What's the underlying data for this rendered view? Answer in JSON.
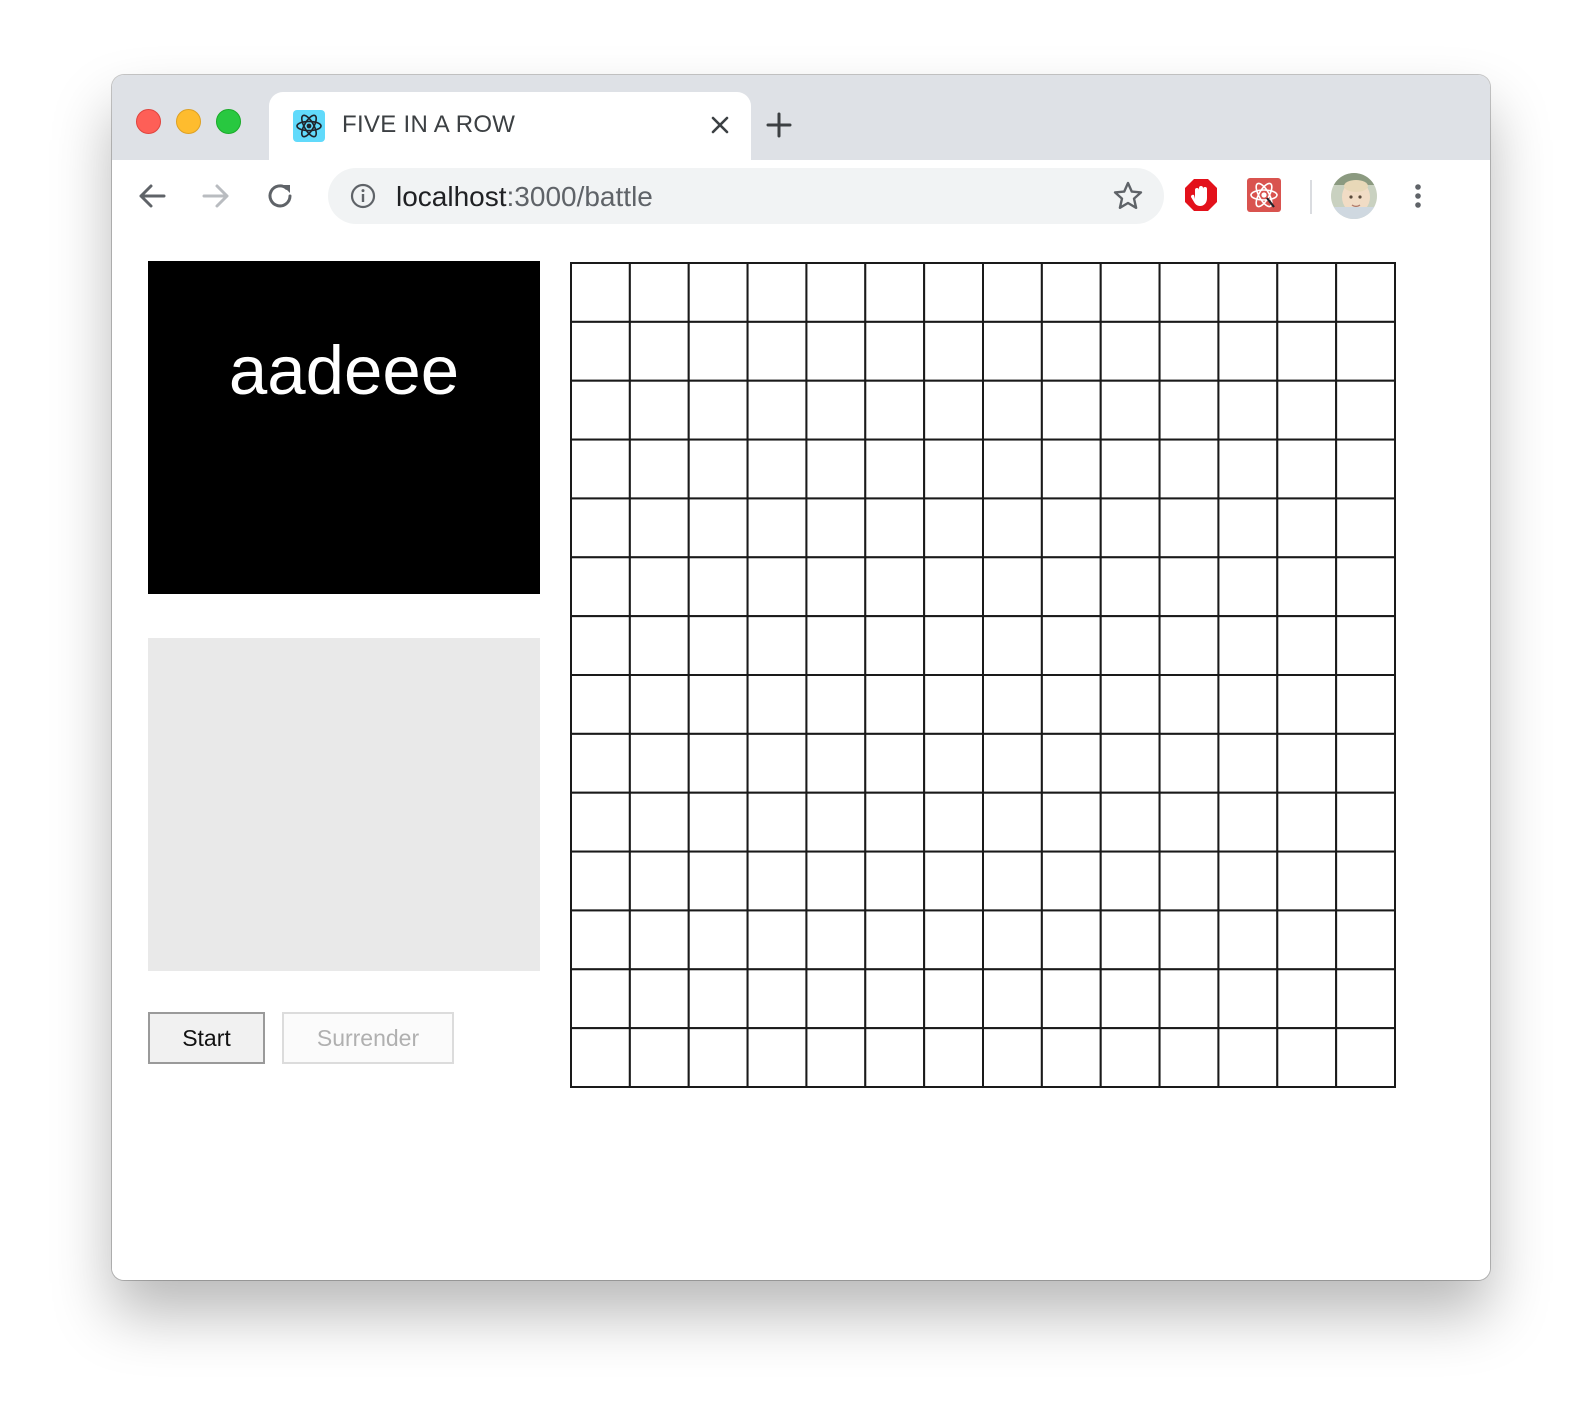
{
  "browser": {
    "tab_title": "FIVE IN A ROW",
    "tab_favicon": "react-atom-icon",
    "url_host": "localhost",
    "url_rest": ":3000/battle",
    "icons": {
      "back": "arrow-left-icon",
      "forward": "arrow-right-icon",
      "reload": "reload-icon",
      "site_info": "info-icon",
      "bookmark": "star-icon",
      "extension_1": "stop-hand-icon",
      "extension_2": "react-devtools-icon",
      "menu": "kebab-menu-icon",
      "close_tab": "close-icon",
      "new_tab": "plus-icon"
    }
  },
  "game": {
    "player_name": "aadeee",
    "start_label": "Start",
    "surrender_label": "Surrender",
    "board_size": 14
  },
  "colors": {
    "player_card": "#000000",
    "opponent_card": "#e9e9e9",
    "grid_line": "#1a1a1a"
  }
}
